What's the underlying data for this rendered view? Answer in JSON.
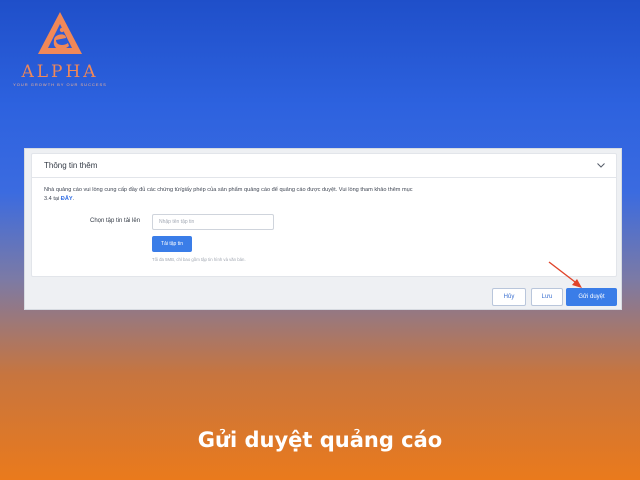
{
  "brand": {
    "name": "ALPHA",
    "tagline": "YOUR GROWTH BY OUR SUCCESS",
    "color": "#f08858"
  },
  "panel": {
    "title": "Thông tin thêm",
    "description": "Nhà quảng cáo vui lòng cung cấp đầy đủ các chứng từ/giấy phép của sản phẩm quảng cáo để quảng cáo được duyệt. Vui lòng tham khảo thêm mục 3.4 tại ",
    "description_link": "ĐÂY",
    "description_end": ".",
    "file_label": "Chọn tập tin tải lên",
    "file_placeholder": "Nhập tên tập tin",
    "upload_button": "Tải tập tin",
    "hint": "Tối đa 5MB, chỉ bao gồm tập tin hình và văn bản."
  },
  "actions": {
    "cancel": "Hủy",
    "save": "Lưu",
    "submit": "Gửi duyệt"
  },
  "colors": {
    "accent": "#3a7de8",
    "arrow": "#e0442a"
  },
  "caption": "Gửi duyệt quảng cáo"
}
